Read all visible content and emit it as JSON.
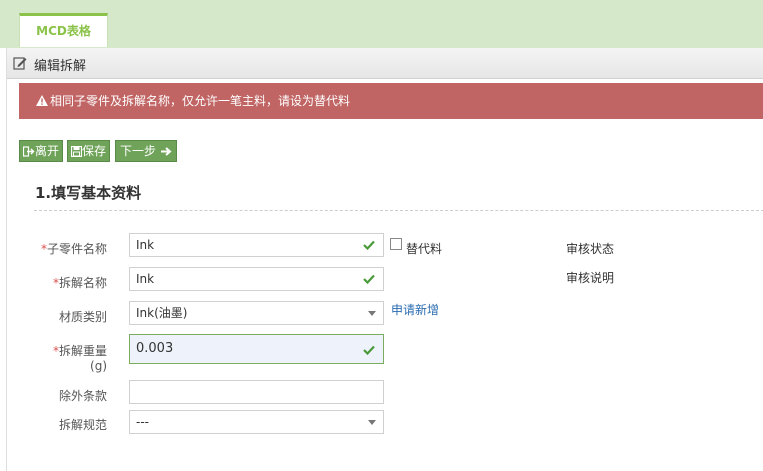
{
  "tabs": [
    {
      "label": "MCD表格"
    }
  ],
  "panel": {
    "title": "编辑拆解"
  },
  "alert": {
    "text": "相同子零件及拆解名称，仅允许一笔主料，请设为替代料"
  },
  "toolbar": {
    "leave_label": "离开",
    "save_label": "保存",
    "next_label": "下一步"
  },
  "section": {
    "title": "1.填写基本资料"
  },
  "form": {
    "part_name_label": "子零件名称",
    "part_name_value": "Ink",
    "substitute_label": "替代料",
    "disassembly_name_label": "拆解名称",
    "disassembly_name_value": "Ink",
    "material_label": "材质类别",
    "material_value": "Ink(油墨)",
    "apply_new_label": "申请新增",
    "weight_label": "拆解重量",
    "weight_unit": "(g)",
    "weight_value": "0.003",
    "exclusion_label": "除外条款",
    "exclusion_value": "",
    "spec_label": "拆解规范",
    "spec_value": "---",
    "review_status_label": "审核状态",
    "review_note_label": "审核说明"
  },
  "colors": {
    "accent": "#8bc34a",
    "button": "#6fa35a",
    "alert": "#c06464",
    "link": "#2a6cb0"
  }
}
